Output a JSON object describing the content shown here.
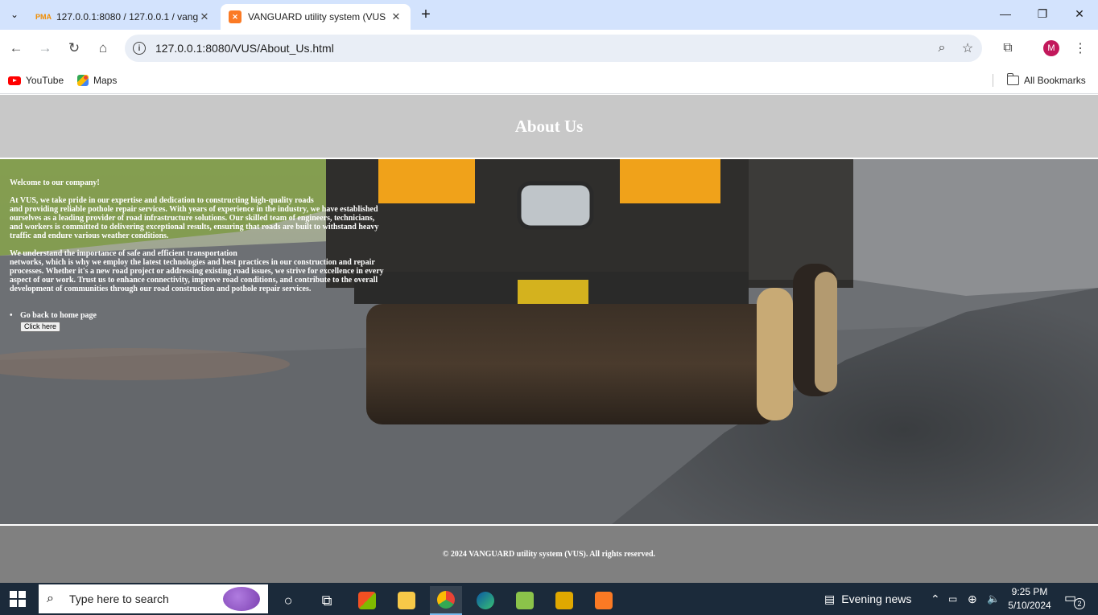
{
  "browser": {
    "tabs": [
      {
        "title": "127.0.0.1:8080 / 127.0.0.1 / vang",
        "favicon": "phpmyadmin-icon",
        "active": false
      },
      {
        "title": "VANGUARD utility system (VUS",
        "favicon": "xampp-icon",
        "active": true
      }
    ],
    "close_glyph": "✕",
    "new_tab_glyph": "+",
    "url": "127.0.0.1:8080/VUS/About_Us.html",
    "profile_initial": "M",
    "bookmarks": [
      {
        "label": "YouTube",
        "icon": "youtube-icon"
      },
      {
        "label": "Maps",
        "icon": "maps-icon"
      }
    ],
    "all_bookmarks_label": "All Bookmarks"
  },
  "page": {
    "header_title": "About Us",
    "welcome": "Welcome to our company!",
    "paragraph1": "At VUS, we take pride in our expertise and dedication to constructing high-quality roads\nand providing reliable pothole repair services. With years of experience in the industry, we have established\nourselves as a leading provider of road infrastructure solutions. Our skilled team of engineers, technicians,\nand workers is committed to delivering exceptional results, ensuring that roads are built to withstand heavy\ntraffic and endure various weather conditions.",
    "paragraph2": "We understand the importance of safe and efficient transportation\nnetworks, which is why we employ the latest technologies and best practices in our construction and repair\nprocesses. Whether it's a new road project or addressing existing road issues, we strive for excellence in every\naspect of our work. Trust us to enhance connectivity, improve road conditions, and contribute to the overall\ndevelopment of communities through our road construction and pothole repair services.",
    "home_link_text": "Go back to home page",
    "home_button_label": "Click here",
    "footer_text": "© 2024 VANGUARD utility system (VUS). All rights reserved."
  },
  "taskbar": {
    "search_placeholder": "Type here to search",
    "news_label": "Evening news",
    "time": "9:25 PM",
    "date": "5/10/2024",
    "notification_count": "2"
  },
  "colors": {
    "tabbar": "#d3e3fd",
    "header_bg": "#c8c8c8",
    "footer_bg": "#808080",
    "taskbar_bg": "#1b2a3a"
  }
}
